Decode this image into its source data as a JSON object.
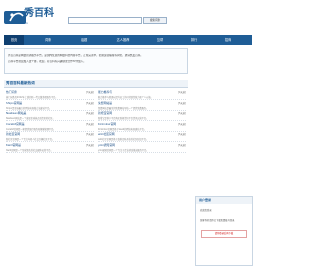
{
  "header": {
    "logo_text": "秀百科",
    "logo_url": "www.xowiki.cn",
    "search_placeholder": "",
    "search_button": "搜索词条"
  },
  "nav": {
    "items": [
      "首页",
      "词条",
      "话题",
      "达人推荐",
      "互帮",
      "排行",
      "招商"
    ]
  },
  "notice": {
    "line1": "秀百百科是网络营销服务平台，是国内优质的网络科普内容平台，正在完善中，招募运营编辑等岗位，邀请热爱百科。",
    "line2": "百科平台欢迎加入这个群，欢迎，对百科有兴趣朋友合作伙伴加入。"
  },
  "hot": {
    "title": "秀百百科最新热词",
    "items": [
      {
        "title": "热门词条",
        "date": "[3天前]",
        "desc": "热门词条库2022年上线的新一代正版游戏服务平台。"
      },
      {
        "title": "能力推荐与",
        "date": "[4天前]",
        "desc": "能力推荐与管理以提升员工的可持续性能力和个人价值。"
      },
      {
        "title": "Shipo官网是",
        "date": "[5天前]",
        "desc": "Shipo是全球最大的跨境电商独立站建站平台。"
      },
      {
        "title": "免费网站是",
        "date": "[5天前]",
        "desc": "免费网站是最全的免费网站导航一个提供免费服务。"
      },
      {
        "title": "Neeteen网站是",
        "date": "[5天前]",
        "desc": "Neeteen网站是一个发现全球热点和资讯的社区。"
      },
      {
        "title": "新增宝官网",
        "date": "[5天前]",
        "desc": "新增宝是基于平台购买新闻资讯平台资讯运营平台。"
      },
      {
        "title": "Carebit官网是",
        "date": "[5天前]",
        "desc": "Carebit官网是一家提供医疗服务和健康管理平台。"
      },
      {
        "title": "Kinlinksx官网",
        "date": "[5天前]",
        "desc": "Kinlinksx官网是基于SaaS的跨境电商建站平台。"
      },
      {
        "title": "新社区官网",
        "date": "[5天前]",
        "desc": "新社区官网是一个专注年轻人社交兴趣社区平台。"
      },
      {
        "title": "wiki社区官网",
        "date": "[5天前]",
        "desc": "wiki社区官网是基于维基百科开放的社区知识平台。"
      },
      {
        "title": "tiwili官网是",
        "date": "[5天前]",
        "desc": "tiwili官网是一个全球领先的社交媒体运营平台。"
      },
      {
        "title": "yoki通知官网",
        "date": "[5天前]",
        "desc": "yoki通知官网是一个专注于企业消息推送服务平台。"
      }
    ]
  },
  "side": {
    "title": "用户登录",
    "welcome": "欢迎您登录",
    "text": "游客你好请你已下载免费账号登录",
    "button": "请你登录后再下载"
  }
}
